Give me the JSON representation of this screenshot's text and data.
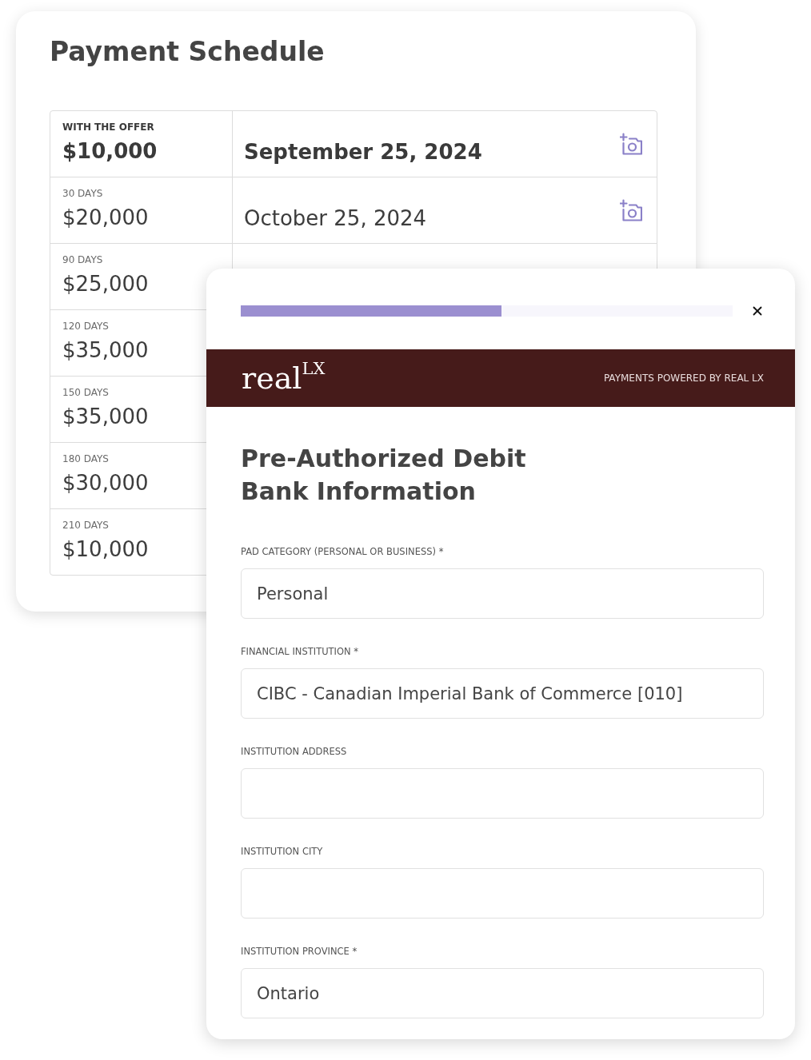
{
  "schedule": {
    "title": "Payment Schedule",
    "rows": [
      {
        "label": "WITH THE OFFER",
        "amount": "$10,000",
        "date": "September 25, 2024",
        "emphasized": true
      },
      {
        "label": "30 DAYS",
        "amount": "$20,000",
        "date": "October 25, 2024",
        "emphasized": false
      },
      {
        "label": "90 DAYS",
        "amount": "$25,000",
        "emphasized": false
      },
      {
        "label": "120 DAYS",
        "amount": "$35,000",
        "emphasized": false
      },
      {
        "label": "150 DAYS",
        "amount": "$35,000",
        "emphasized": false
      },
      {
        "label": "180 DAYS",
        "amount": "$30,000",
        "emphasized": false
      },
      {
        "label": "210 DAYS",
        "amount": "$10,000",
        "emphasized": false
      }
    ]
  },
  "modal": {
    "progress": {
      "level": 0.53
    },
    "brand": {
      "logo": "real$^{LX}$",
      "tagline": "PAYMENTS POWERED BY REAL LX"
    },
    "heading_lines": [
      "Pre-Authorized Debit",
      "Bank Information"
    ],
    "fields": [
      {
        "label": "PAD CATEGORY (PERSONAL OR BUSINESS) *",
        "value": "Personal"
      },
      {
        "label": "FINANCIAL INSTITUTION *",
        "value": "CIBC - Canadian Imperial Bank of Commerce [010]"
      },
      {
        "label": "INSTITUTION ADDRESS"
      },
      {
        "label": "INSTITUTION CITY"
      },
      {
        "label": "INSTITUTION PROVINCE *",
        "value": "Ontario"
      }
    ]
  }
}
